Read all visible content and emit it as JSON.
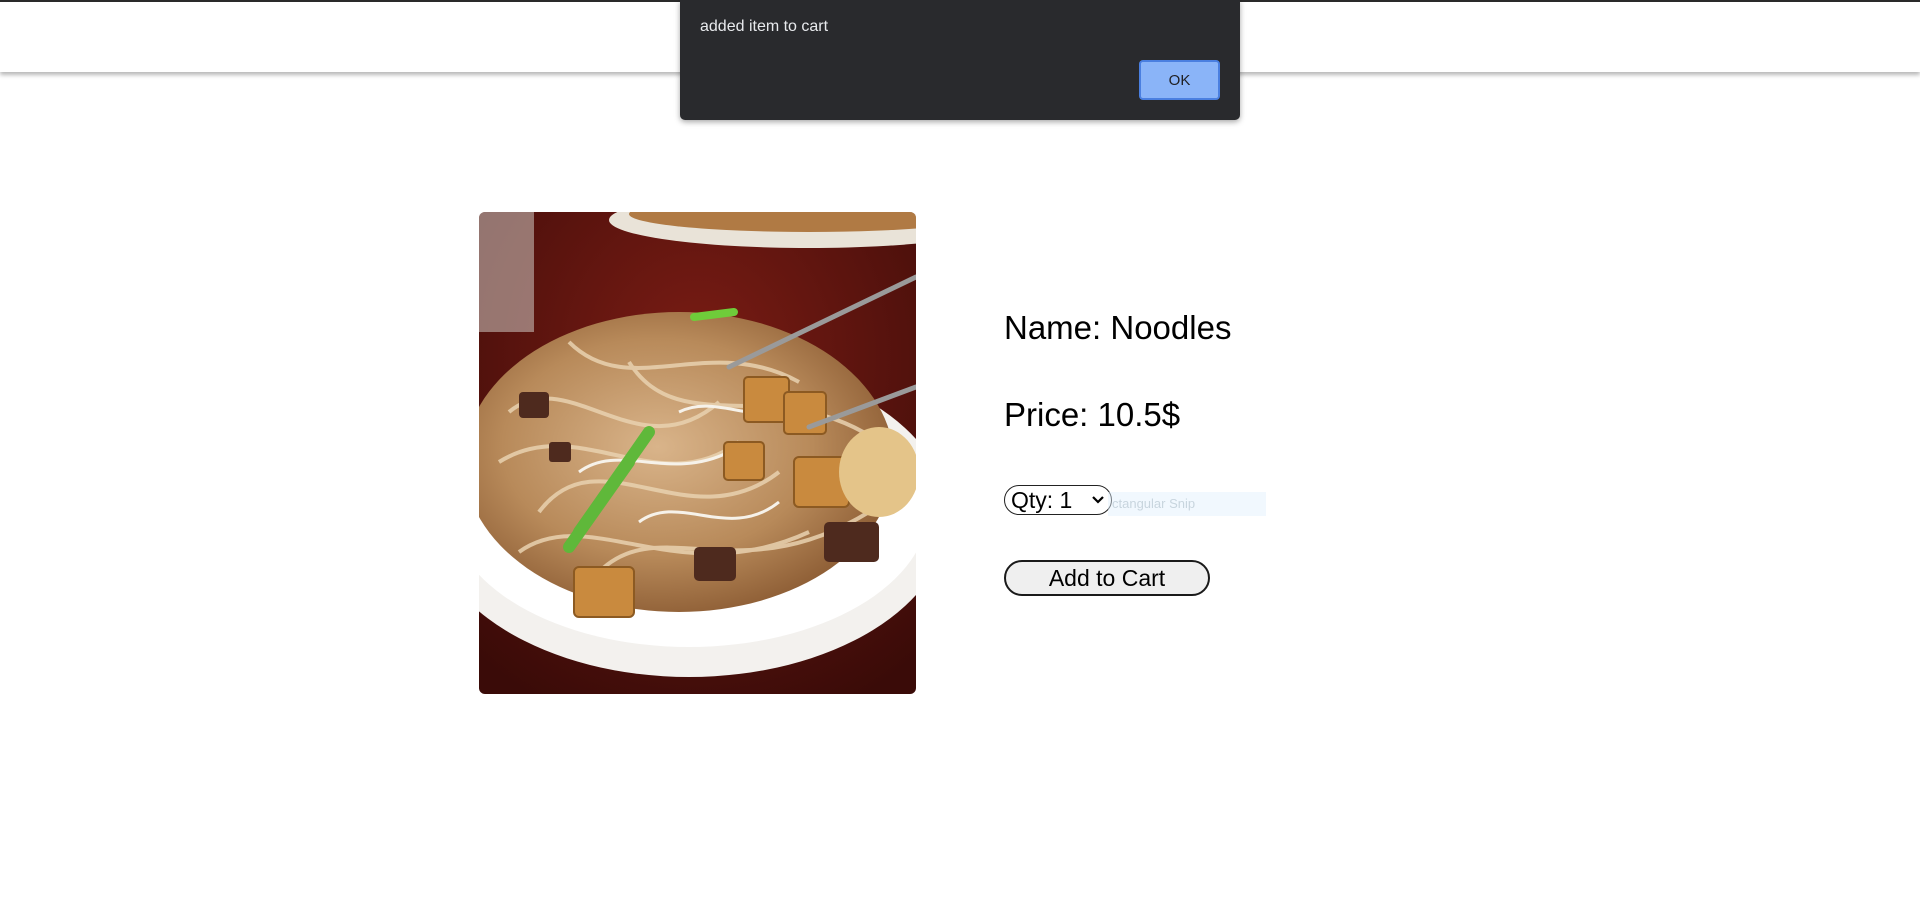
{
  "alert": {
    "message": "added item to cart",
    "ok_label": "OK"
  },
  "product": {
    "name_text": "Name: Noodles",
    "price_text": "Price: 10.5$",
    "image_alt": "noodles-photo",
    "quantity": {
      "selected_text": "Qty: 1"
    },
    "add_to_cart_label": "Add to Cart"
  },
  "overlay": {
    "snip_ghost_text": "ctangular Snip"
  },
  "colors": {
    "alert_bg": "#292a2d",
    "alert_button": "#8ab4f8",
    "button_bg": "#efefef"
  }
}
